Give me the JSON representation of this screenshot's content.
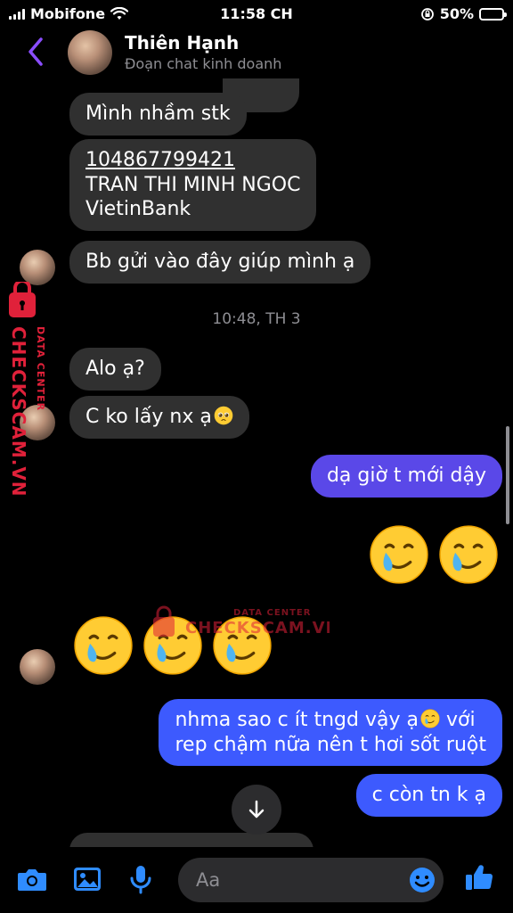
{
  "status": {
    "carrier": "Mobifone",
    "time": "11:58 CH",
    "battery": "50%",
    "battery_level": 0.5
  },
  "header": {
    "name": "Thiên Hạnh",
    "subtitle": "Đoạn chat kinh doanh"
  },
  "messages": {
    "m1": "Mình nhầm stk",
    "m2_account": "104867799421",
    "m2_name": "TRAN THI MINH NGOC",
    "m2_bank": "VietinBank",
    "m3": "Bb gửi vào đây giúp mình ạ",
    "timestamp": "10:48, TH 3",
    "m4": "Alo ạ?",
    "m5": "C ko lấy nx ạ",
    "m6": "dạ giờ t mới dậy",
    "m7_line1": "nhma sao c ít tngd vậy ạ",
    "m7_line1b": " với",
    "m7_line2": "rep chậm nữa nên t hơi sốt ruột",
    "m8": "c còn tn k ạ"
  },
  "watermark": {
    "side_brand": "CHECKSCAM.VN",
    "side_label": "DATA CENTER",
    "center_label": "DATA CENTER",
    "center_brand": "CHECKSCAM.VN"
  },
  "composer": {
    "placeholder": "Aa"
  },
  "icons": {
    "back": "chevron-left-icon",
    "camera": "camera-icon",
    "gallery": "image-icon",
    "mic": "microphone-icon",
    "emoji": "emoji-icon",
    "like": "thumbs-up-icon",
    "scroll": "arrow-down-icon"
  },
  "colors": {
    "accent": "#8a4dff",
    "outgoing": "#3d5afe",
    "incoming": "#303030",
    "watermark": "#e0213a"
  }
}
